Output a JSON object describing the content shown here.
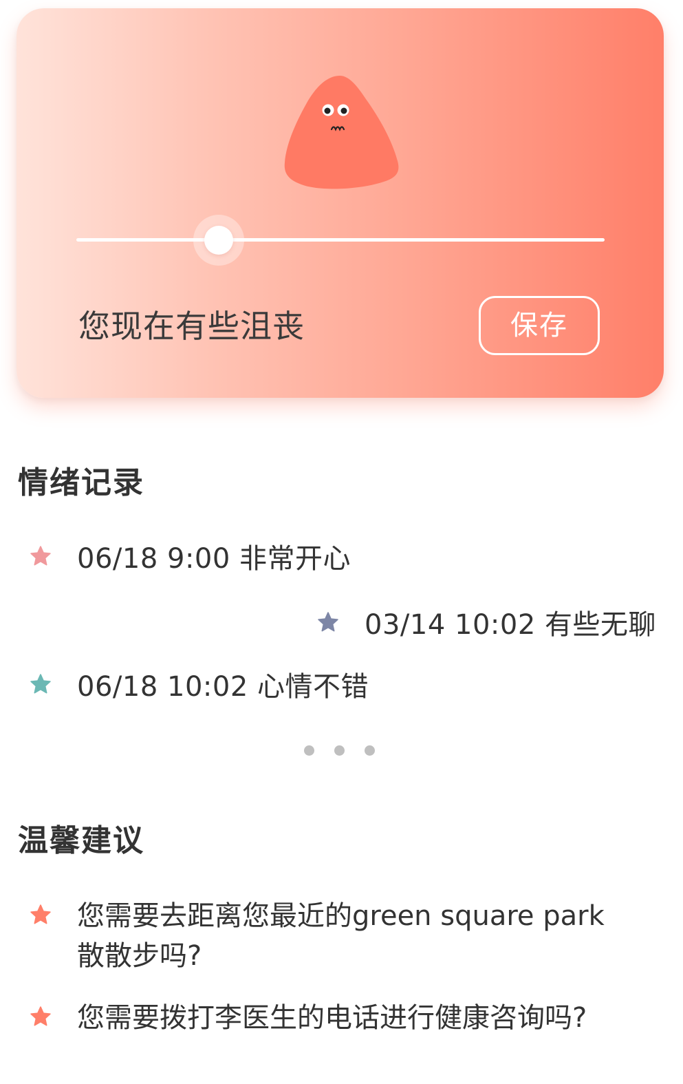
{
  "mood_card": {
    "status_text": "您现在有些沮丧",
    "save_label": "保存",
    "slider_value_percent": 27,
    "mascot": "sad-blob-icon",
    "gradient_colors": [
      "#ffe3da",
      "#ff7f69"
    ]
  },
  "records": {
    "title": "情绪记录",
    "items": [
      {
        "text": "06/18 9:00 非常开心",
        "star_color": "#f0999c",
        "icon": "star-icon"
      },
      {
        "text": "03/14 10:02 有些无聊",
        "star_color": "#7d86a6",
        "icon": "star-icon"
      },
      {
        "text": "06/18 10:02 心情不错",
        "star_color": "#6bb8b4",
        "icon": "star-icon"
      }
    ],
    "more_indicator": "ellipsis-dots"
  },
  "suggestions": {
    "title": "温馨建议",
    "items": [
      {
        "text": "您需要去距离您最近的green square park散散步吗?",
        "star_color": "#ff7f69",
        "icon": "star-icon"
      },
      {
        "text": "您需要拨打李医生的电话进行健康咨询吗?",
        "star_color": "#ff7f69",
        "icon": "star-icon"
      }
    ]
  }
}
